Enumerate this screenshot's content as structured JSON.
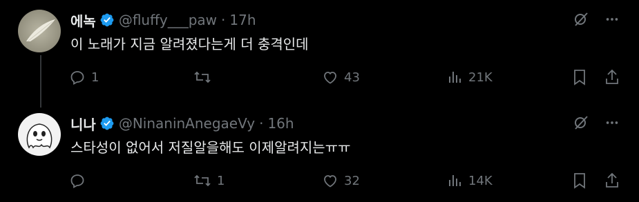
{
  "tweets": [
    {
      "name": "에녹",
      "handle": "@fluffy___paw",
      "separator": "·",
      "time": "17h",
      "text": "이 노래가 지금 알려졌다는게 더 충격인데",
      "replies": "1",
      "retweets": "",
      "likes": "43",
      "views": "21K",
      "avatar": "feather"
    },
    {
      "name": "니나",
      "handle": "@NinaninAnegaeVy",
      "separator": "·",
      "time": "16h",
      "text": "스타성이 없어서 저질알을해도 이제알려지는ㅠㅠ",
      "replies": "",
      "retweets": "1",
      "likes": "32",
      "views": "14K",
      "avatar": "ghost-drawing"
    }
  ],
  "colors": {
    "background": "#000000",
    "text": "#e7e9ea",
    "muted": "#71767b",
    "verified": "#1d9bf0"
  },
  "icons": [
    "verified-badge-icon",
    "grok-icon",
    "more-icon",
    "reply-icon",
    "retweet-icon",
    "like-icon",
    "views-icon",
    "bookmark-icon",
    "share-icon"
  ]
}
